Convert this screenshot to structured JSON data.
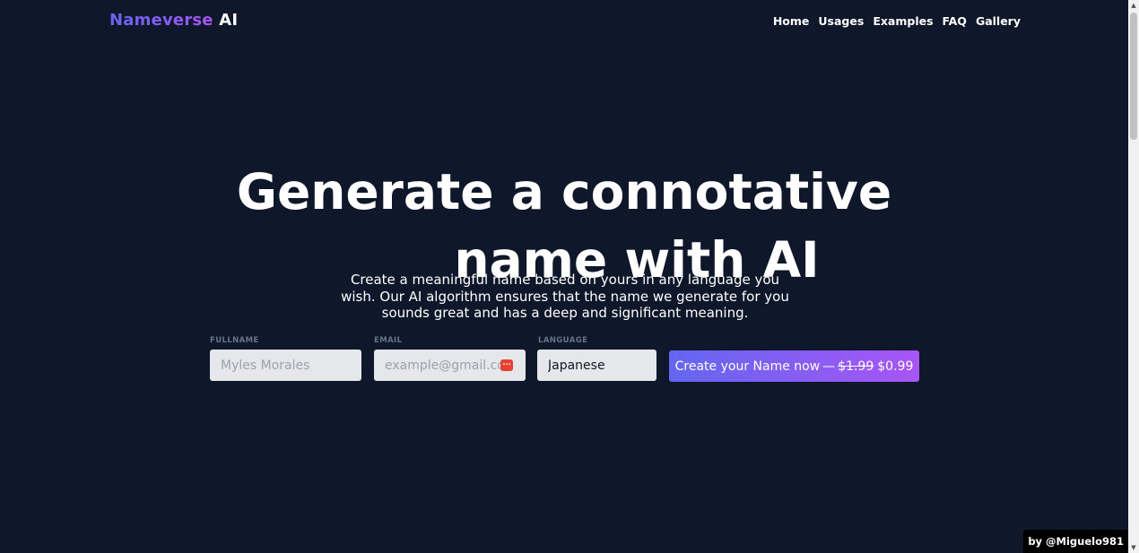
{
  "header": {
    "logo_brand": "Nameverse",
    "logo_suffix": "AI",
    "nav": [
      "Home",
      "Usages",
      "Examples",
      "FAQ",
      "Gallery"
    ]
  },
  "hero": {
    "title_line1": "Generate a connotative",
    "title_line2": "name with AI",
    "subtitle": "Create a meaningful name based on yours in any language you wish. Our AI algorithm ensures that the name we generate for you sounds great and has a deep and significant meaning."
  },
  "form": {
    "fullname_label": "FULLNAME",
    "fullname_placeholder": "Myles Morales",
    "email_label": "EMAIL",
    "email_placeholder": "example@gmail.com",
    "language_label": "LANGUAGE",
    "language_value": "Japanese",
    "submit_label": "Create your Name now",
    "submit_separator": "—",
    "old_price": "$1.99",
    "new_price": "$0.99"
  },
  "credit": "by @Miguelo981",
  "colors": {
    "background": "#0f172a",
    "accent_start": "#6366f1",
    "accent_end": "#a855f7"
  },
  "icons": {
    "email_autofill": "password-manager-icon"
  }
}
